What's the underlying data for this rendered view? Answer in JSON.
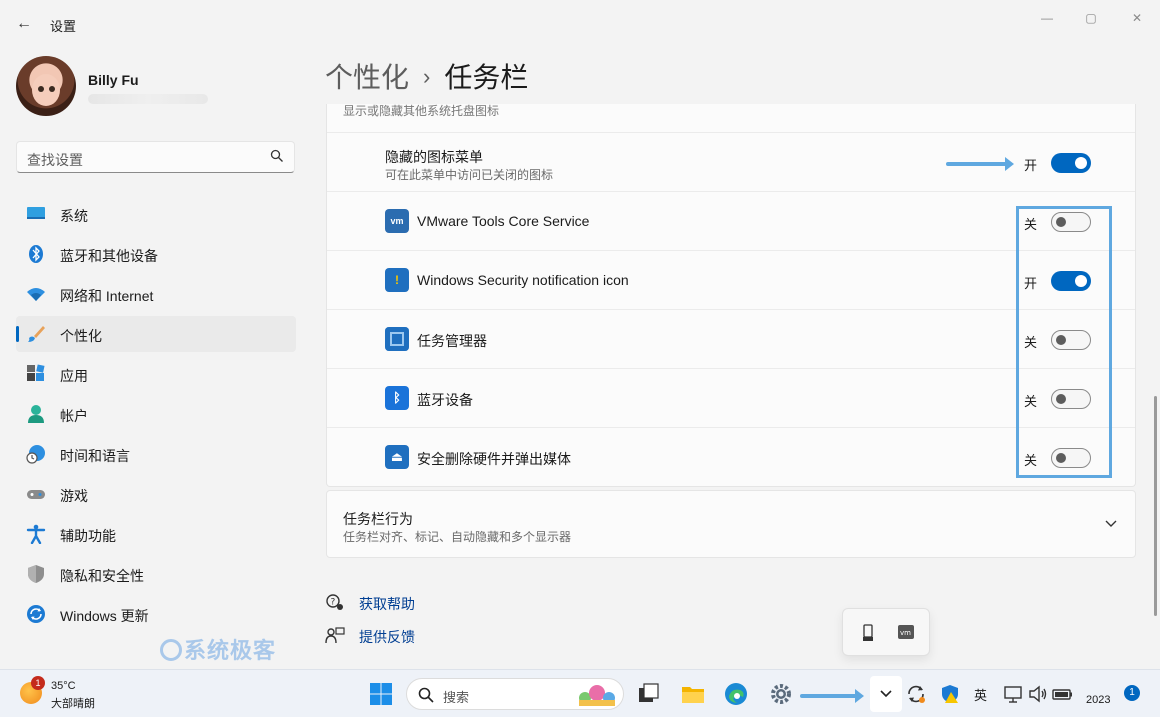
{
  "window": {
    "title": "设置",
    "back_icon": "back-arrow-icon",
    "controls": [
      "minimize",
      "maximize",
      "close"
    ]
  },
  "user": {
    "name": "Billy Fu"
  },
  "search": {
    "placeholder": "查找设置"
  },
  "nav": {
    "items": [
      {
        "label": "系统",
        "icon": "system-icon",
        "active": false
      },
      {
        "label": "蓝牙和其他设备",
        "icon": "bluetooth-icon",
        "active": false
      },
      {
        "label": "网络和 Internet",
        "icon": "wifi-icon",
        "active": false
      },
      {
        "label": "个性化",
        "icon": "brush-icon",
        "active": true
      },
      {
        "label": "应用",
        "icon": "apps-icon",
        "active": false
      },
      {
        "label": "帐户",
        "icon": "account-icon",
        "active": false
      },
      {
        "label": "时间和语言",
        "icon": "globe-clock-icon",
        "active": false
      },
      {
        "label": "游戏",
        "icon": "gamepad-icon",
        "active": false
      },
      {
        "label": "辅助功能",
        "icon": "accessibility-icon",
        "active": false
      },
      {
        "label": "隐私和安全性",
        "icon": "shield-icon",
        "active": false
      },
      {
        "label": "Windows 更新",
        "icon": "update-icon",
        "active": false
      }
    ]
  },
  "watermark": "系统极客",
  "breadcrumb": {
    "parent": "个性化",
    "separator": "›",
    "current": "任务栏"
  },
  "section": {
    "clipped_header": "显示或隐藏其他系统托盘图标",
    "hidden_menu": {
      "title": "隐藏的图标菜单",
      "subtitle": "可在此菜单中访问已关闭的图标",
      "state": "开",
      "on": true
    },
    "items": [
      {
        "label": "VMware Tools Core Service",
        "state": "关",
        "on": false,
        "icon": "vmware-icon",
        "icon_text": "vm"
      },
      {
        "label": "Windows Security notification icon",
        "state": "开",
        "on": true,
        "icon": "windows-security-icon",
        "icon_text": "!"
      },
      {
        "label": "任务管理器",
        "state": "关",
        "on": false,
        "icon": "task-manager-icon",
        "icon_text": ""
      },
      {
        "label": "蓝牙设备",
        "state": "关",
        "on": false,
        "icon": "bluetooth-device-icon",
        "icon_text": "ᛒ"
      },
      {
        "label": "安全删除硬件并弹出媒体",
        "state": "关",
        "on": false,
        "icon": "usb-eject-icon",
        "icon_text": "⏏"
      }
    ]
  },
  "taskbar_behavior": {
    "title": "任务栏行为",
    "subtitle": "任务栏对齐、标记、自动隐藏和多个显示器"
  },
  "links": {
    "help": "获取帮助",
    "feedback": "提供反馈"
  },
  "tray_popup": {
    "icons": [
      "usb-eject-icon",
      "vmware-icon"
    ]
  },
  "taskbar": {
    "weather": {
      "temp": "35°C",
      "desc": "大部晴朗",
      "badge": "1"
    },
    "search_label": "搜索",
    "ime": "英",
    "clock": "2023",
    "notification_count": "1"
  },
  "colors": {
    "accent": "#0067c0",
    "highlight": "#5fa8e0",
    "background": "#f3f3f3"
  }
}
